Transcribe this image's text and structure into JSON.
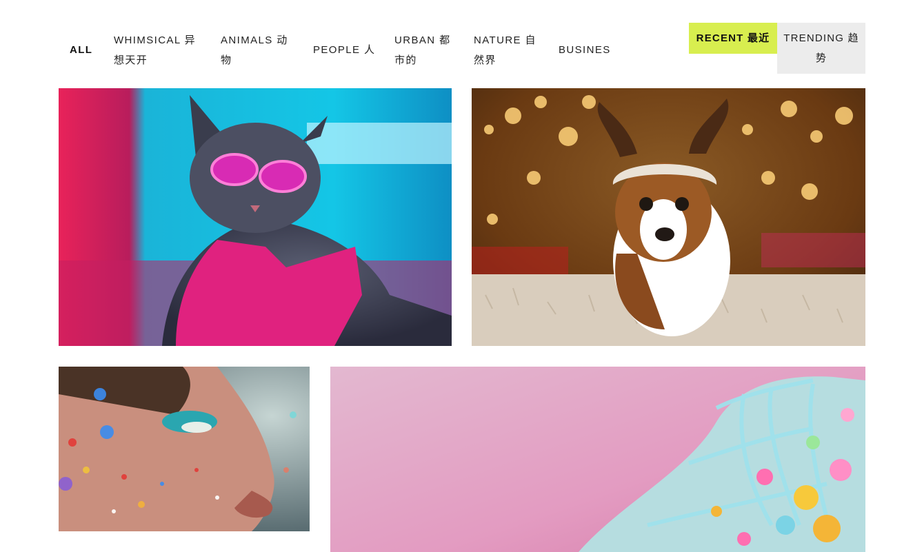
{
  "categories": [
    {
      "id": "all",
      "label": "ALL",
      "active": true
    },
    {
      "id": "whimsical",
      "label": "WHIMSICAL 异想天开"
    },
    {
      "id": "animals",
      "label": "ANIMALS 动物"
    },
    {
      "id": "people",
      "label": "PEOPLE 人"
    },
    {
      "id": "urban",
      "label": "URBAN 都市的"
    },
    {
      "id": "nature",
      "label": "NATURE 自然界"
    },
    {
      "id": "business",
      "label": "BUSINESS"
    }
  ],
  "sort": {
    "recent_label": "RECENT 最近",
    "trending_label": "TRENDING 趋势",
    "active": "recent"
  },
  "gallery": [
    {
      "id": "cat",
      "subject": "cat in pink sunglasses and pink jacket"
    },
    {
      "id": "dog",
      "subject": "puppy wearing reindeer antlers hat"
    },
    {
      "id": "face",
      "subject": "woman face covered in glitter"
    },
    {
      "id": "shoe",
      "subject": "sneaker decorated with candy and blue laces"
    }
  ],
  "colors": {
    "accent_active": "#d8ee4f",
    "inactive_bg": "#ececec"
  }
}
